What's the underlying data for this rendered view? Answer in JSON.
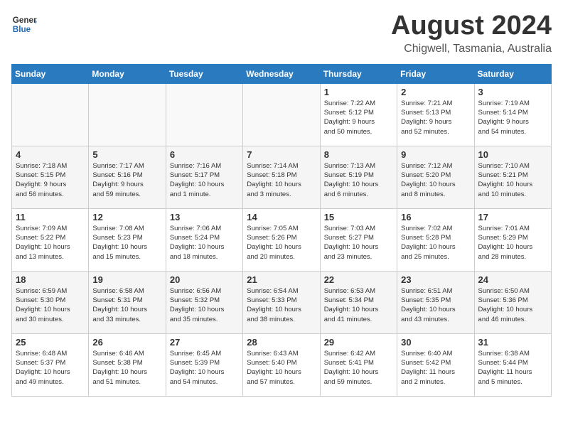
{
  "header": {
    "logo_general": "General",
    "logo_blue": "Blue",
    "main_title": "August 2024",
    "subtitle": "Chigwell, Tasmania, Australia"
  },
  "calendar": {
    "headers": [
      "Sunday",
      "Monday",
      "Tuesday",
      "Wednesday",
      "Thursday",
      "Friday",
      "Saturday"
    ],
    "weeks": [
      [
        {
          "day": "",
          "info": ""
        },
        {
          "day": "",
          "info": ""
        },
        {
          "day": "",
          "info": ""
        },
        {
          "day": "",
          "info": ""
        },
        {
          "day": "1",
          "info": "Sunrise: 7:22 AM\nSunset: 5:12 PM\nDaylight: 9 hours\nand 50 minutes."
        },
        {
          "day": "2",
          "info": "Sunrise: 7:21 AM\nSunset: 5:13 PM\nDaylight: 9 hours\nand 52 minutes."
        },
        {
          "day": "3",
          "info": "Sunrise: 7:19 AM\nSunset: 5:14 PM\nDaylight: 9 hours\nand 54 minutes."
        }
      ],
      [
        {
          "day": "4",
          "info": "Sunrise: 7:18 AM\nSunset: 5:15 PM\nDaylight: 9 hours\nand 56 minutes."
        },
        {
          "day": "5",
          "info": "Sunrise: 7:17 AM\nSunset: 5:16 PM\nDaylight: 9 hours\nand 59 minutes."
        },
        {
          "day": "6",
          "info": "Sunrise: 7:16 AM\nSunset: 5:17 PM\nDaylight: 10 hours\nand 1 minute."
        },
        {
          "day": "7",
          "info": "Sunrise: 7:14 AM\nSunset: 5:18 PM\nDaylight: 10 hours\nand 3 minutes."
        },
        {
          "day": "8",
          "info": "Sunrise: 7:13 AM\nSunset: 5:19 PM\nDaylight: 10 hours\nand 6 minutes."
        },
        {
          "day": "9",
          "info": "Sunrise: 7:12 AM\nSunset: 5:20 PM\nDaylight: 10 hours\nand 8 minutes."
        },
        {
          "day": "10",
          "info": "Sunrise: 7:10 AM\nSunset: 5:21 PM\nDaylight: 10 hours\nand 10 minutes."
        }
      ],
      [
        {
          "day": "11",
          "info": "Sunrise: 7:09 AM\nSunset: 5:22 PM\nDaylight: 10 hours\nand 13 minutes."
        },
        {
          "day": "12",
          "info": "Sunrise: 7:08 AM\nSunset: 5:23 PM\nDaylight: 10 hours\nand 15 minutes."
        },
        {
          "day": "13",
          "info": "Sunrise: 7:06 AM\nSunset: 5:24 PM\nDaylight: 10 hours\nand 18 minutes."
        },
        {
          "day": "14",
          "info": "Sunrise: 7:05 AM\nSunset: 5:26 PM\nDaylight: 10 hours\nand 20 minutes."
        },
        {
          "day": "15",
          "info": "Sunrise: 7:03 AM\nSunset: 5:27 PM\nDaylight: 10 hours\nand 23 minutes."
        },
        {
          "day": "16",
          "info": "Sunrise: 7:02 AM\nSunset: 5:28 PM\nDaylight: 10 hours\nand 25 minutes."
        },
        {
          "day": "17",
          "info": "Sunrise: 7:01 AM\nSunset: 5:29 PM\nDaylight: 10 hours\nand 28 minutes."
        }
      ],
      [
        {
          "day": "18",
          "info": "Sunrise: 6:59 AM\nSunset: 5:30 PM\nDaylight: 10 hours\nand 30 minutes."
        },
        {
          "day": "19",
          "info": "Sunrise: 6:58 AM\nSunset: 5:31 PM\nDaylight: 10 hours\nand 33 minutes."
        },
        {
          "day": "20",
          "info": "Sunrise: 6:56 AM\nSunset: 5:32 PM\nDaylight: 10 hours\nand 35 minutes."
        },
        {
          "day": "21",
          "info": "Sunrise: 6:54 AM\nSunset: 5:33 PM\nDaylight: 10 hours\nand 38 minutes."
        },
        {
          "day": "22",
          "info": "Sunrise: 6:53 AM\nSunset: 5:34 PM\nDaylight: 10 hours\nand 41 minutes."
        },
        {
          "day": "23",
          "info": "Sunrise: 6:51 AM\nSunset: 5:35 PM\nDaylight: 10 hours\nand 43 minutes."
        },
        {
          "day": "24",
          "info": "Sunrise: 6:50 AM\nSunset: 5:36 PM\nDaylight: 10 hours\nand 46 minutes."
        }
      ],
      [
        {
          "day": "25",
          "info": "Sunrise: 6:48 AM\nSunset: 5:37 PM\nDaylight: 10 hours\nand 49 minutes."
        },
        {
          "day": "26",
          "info": "Sunrise: 6:46 AM\nSunset: 5:38 PM\nDaylight: 10 hours\nand 51 minutes."
        },
        {
          "day": "27",
          "info": "Sunrise: 6:45 AM\nSunset: 5:39 PM\nDaylight: 10 hours\nand 54 minutes."
        },
        {
          "day": "28",
          "info": "Sunrise: 6:43 AM\nSunset: 5:40 PM\nDaylight: 10 hours\nand 57 minutes."
        },
        {
          "day": "29",
          "info": "Sunrise: 6:42 AM\nSunset: 5:41 PM\nDaylight: 10 hours\nand 59 minutes."
        },
        {
          "day": "30",
          "info": "Sunrise: 6:40 AM\nSunset: 5:42 PM\nDaylight: 11 hours\nand 2 minutes."
        },
        {
          "day": "31",
          "info": "Sunrise: 6:38 AM\nSunset: 5:44 PM\nDaylight: 11 hours\nand 5 minutes."
        }
      ]
    ]
  }
}
